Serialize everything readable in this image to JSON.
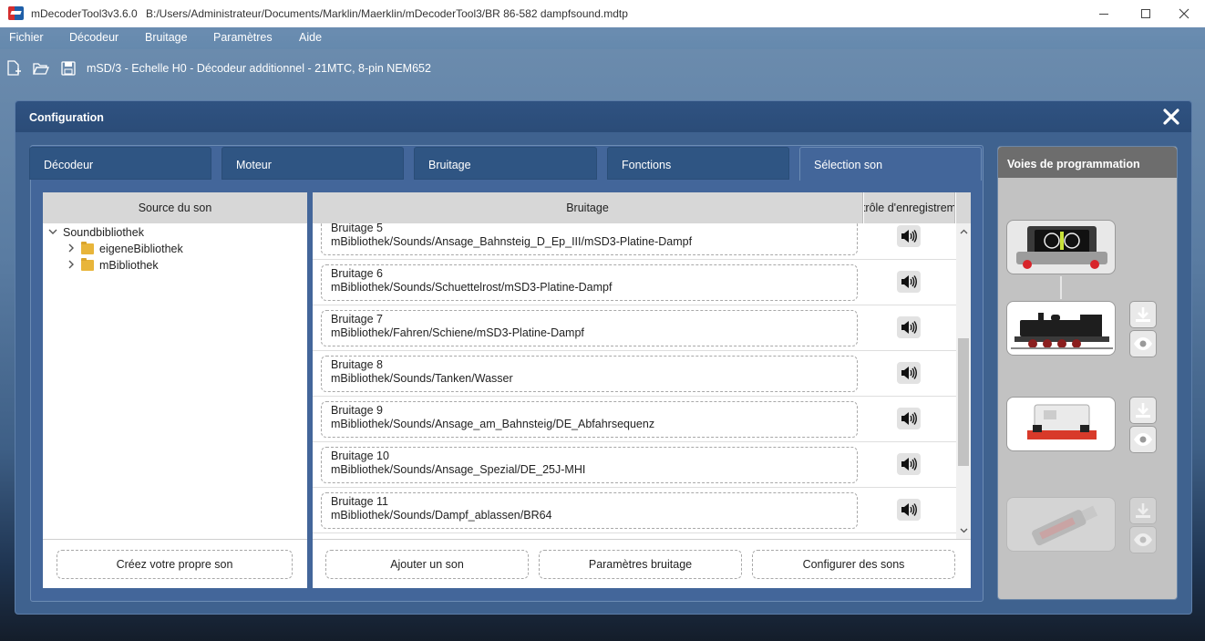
{
  "window": {
    "app_name": "mDecoderTool3",
    "version": "v3.6.0",
    "file_path": "B:/Users/Administrateur/Documents/Marklin/Maerklin/mDecoderTool3/BR 86-582 dampfsound.mdtp"
  },
  "menu": [
    "Fichier",
    "Décodeur",
    "Bruitage",
    "Paramètres",
    "Aide"
  ],
  "toolbar": {
    "decoder_description": "mSD/3 - Echelle H0 - Décodeur additionnel - 21MTC, 8-pin NEM652"
  },
  "config": {
    "title": "Configuration",
    "tabs": [
      "Décodeur",
      "Moteur",
      "Bruitage",
      "Fonctions",
      "Sélection son"
    ],
    "active_tab": "Sélection son"
  },
  "source": {
    "header": "Source du son",
    "tree_root": "Soundbibliothek",
    "tree_children": [
      "eigeneBibliothek",
      "mBibliothek"
    ],
    "create_button": "Créez votre propre son"
  },
  "sound_list": {
    "header_name": "Bruitage",
    "header_control": "trôle d'enregistrem",
    "rows": [
      {
        "title": "Bruitage 5",
        "path": "mBibliothek/Sounds/Ansage_Bahnsteig_D_Ep_III/mSD3-Platine-Dampf"
      },
      {
        "title": "Bruitage 6",
        "path": "mBibliothek/Sounds/Schuettelrost/mSD3-Platine-Dampf"
      },
      {
        "title": "Bruitage 7",
        "path": "mBibliothek/Fahren/Schiene/mSD3-Platine-Dampf"
      },
      {
        "title": "Bruitage 8",
        "path": "mBibliothek/Sounds/Tanken/Wasser"
      },
      {
        "title": "Bruitage 9",
        "path": "mBibliothek/Sounds/Ansage_am_Bahnsteig/DE_Abfahrsequenz"
      },
      {
        "title": "Bruitage 10",
        "path": "mBibliothek/Sounds/Ansage_Spezial/DE_25J-MHI"
      },
      {
        "title": "Bruitage 11",
        "path": "mBibliothek/Sounds/Dampf_ablassen/BR64"
      }
    ],
    "buttons": {
      "add": "Ajouter un son",
      "params": "Paramètres bruitage",
      "configure": "Configurer des sons"
    }
  },
  "programming": {
    "title": "Voies de programmation"
  },
  "icons": {
    "new_file": "new-file-icon",
    "open_folder": "open-folder-icon",
    "save": "save-icon",
    "close": "close-icon",
    "speaker": "speaker-icon",
    "download": "download-icon",
    "eye": "eye-icon"
  },
  "colors": {
    "panel_blue": "#3f628f",
    "tab_blue": "#2f5583",
    "header_gray": "#d7d7d7",
    "prog_header": "#6d6d6d"
  }
}
